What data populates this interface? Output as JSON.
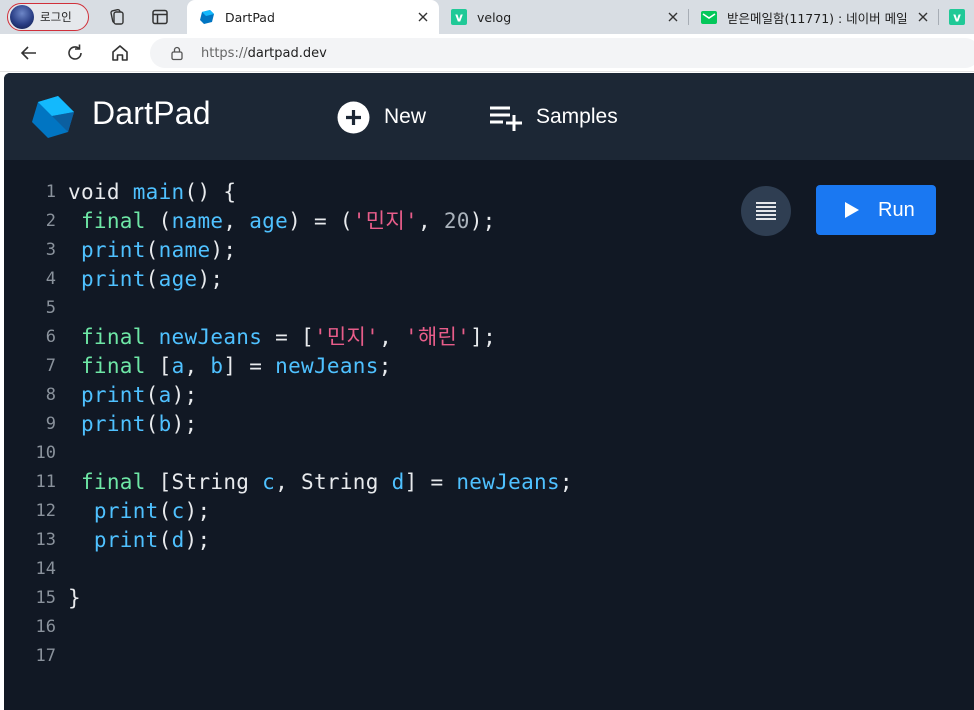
{
  "browser": {
    "profile_label": "로그인",
    "tabs": [
      {
        "label": "DartPad",
        "active": true
      },
      {
        "label": "velog",
        "active": false
      },
      {
        "label": "받은메일함(11771) : 네이버 메일",
        "active": false
      },
      {
        "label": "",
        "active": false
      }
    ],
    "address": {
      "scheme": "https://",
      "host": "dartpad.dev"
    }
  },
  "colors": {
    "app_bg": "#111824",
    "header_bg": "#1c2735",
    "run_button": "#1a78f2",
    "keyword": "#6ee7a6",
    "identifier": "#4fc1ff",
    "string": "#e85d8a",
    "number": "#aab2bb"
  },
  "dartpad": {
    "title": "DartPad",
    "new_label": "New",
    "samples_label": "Samples",
    "run_label": "Run",
    "icons": {
      "logo": "dart-logo-icon",
      "new": "plus-circle-icon",
      "samples": "playlist-add-icon",
      "format": "format-align-icon",
      "run": "play-icon"
    }
  },
  "editor": {
    "line_numbers": [
      "1",
      "2",
      "3",
      "4",
      "5",
      "6",
      "7",
      "8",
      "9",
      "10",
      "11",
      "12",
      "13",
      "14",
      "15",
      "16",
      "17"
    ],
    "lines": [
      [
        {
          "t": "void ",
          "c": "ty"
        },
        {
          "t": "main",
          "c": "fn"
        },
        {
          "t": "() {",
          "c": "ty"
        }
      ],
      [
        {
          "t": " final",
          "c": "kw"
        },
        {
          "t": " (",
          "c": "ty"
        },
        {
          "t": "name",
          "c": "var"
        },
        {
          "t": ", ",
          "c": "ty"
        },
        {
          "t": "age",
          "c": "var"
        },
        {
          "t": ") = (",
          "c": "ty"
        },
        {
          "t": "'민지'",
          "c": "str"
        },
        {
          "t": ", ",
          "c": "ty"
        },
        {
          "t": "20",
          "c": "num"
        },
        {
          "t": ");",
          "c": "ty"
        }
      ],
      [
        {
          "t": " print",
          "c": "fn"
        },
        {
          "t": "(",
          "c": "ty"
        },
        {
          "t": "name",
          "c": "var"
        },
        {
          "t": ");",
          "c": "ty"
        }
      ],
      [
        {
          "t": " print",
          "c": "fn"
        },
        {
          "t": "(",
          "c": "ty"
        },
        {
          "t": "age",
          "c": "var"
        },
        {
          "t": ");",
          "c": "ty"
        }
      ],
      [],
      [
        {
          "t": " final",
          "c": "kw"
        },
        {
          "t": " newJeans",
          "c": "var"
        },
        {
          "t": " = [",
          "c": "ty"
        },
        {
          "t": "'민지'",
          "c": "str"
        },
        {
          "t": ", ",
          "c": "ty"
        },
        {
          "t": "'해린'",
          "c": "str"
        },
        {
          "t": "];",
          "c": "ty"
        }
      ],
      [
        {
          "t": " final",
          "c": "kw"
        },
        {
          "t": " [",
          "c": "ty"
        },
        {
          "t": "a",
          "c": "var"
        },
        {
          "t": ", ",
          "c": "ty"
        },
        {
          "t": "b",
          "c": "var"
        },
        {
          "t": "] = ",
          "c": "ty"
        },
        {
          "t": "newJeans",
          "c": "var"
        },
        {
          "t": ";",
          "c": "ty"
        }
      ],
      [
        {
          "t": " print",
          "c": "fn"
        },
        {
          "t": "(",
          "c": "ty"
        },
        {
          "t": "a",
          "c": "var"
        },
        {
          "t": ");",
          "c": "ty"
        }
      ],
      [
        {
          "t": " print",
          "c": "fn"
        },
        {
          "t": "(",
          "c": "ty"
        },
        {
          "t": "b",
          "c": "var"
        },
        {
          "t": ");",
          "c": "ty"
        }
      ],
      [],
      [
        {
          "t": " final",
          "c": "kw"
        },
        {
          "t": " [String ",
          "c": "ty"
        },
        {
          "t": "c",
          "c": "var"
        },
        {
          "t": ", String ",
          "c": "ty"
        },
        {
          "t": "d",
          "c": "var"
        },
        {
          "t": "] = ",
          "c": "ty"
        },
        {
          "t": "newJeans",
          "c": "var"
        },
        {
          "t": ";",
          "c": "ty"
        }
      ],
      [
        {
          "t": "  print",
          "c": "fn"
        },
        {
          "t": "(",
          "c": "ty"
        },
        {
          "t": "c",
          "c": "var"
        },
        {
          "t": ");",
          "c": "ty"
        }
      ],
      [
        {
          "t": "  print",
          "c": "fn"
        },
        {
          "t": "(",
          "c": "ty"
        },
        {
          "t": "d",
          "c": "var"
        },
        {
          "t": ");",
          "c": "ty"
        }
      ],
      [],
      [
        {
          "t": "}",
          "c": "ty"
        }
      ],
      [],
      []
    ]
  }
}
